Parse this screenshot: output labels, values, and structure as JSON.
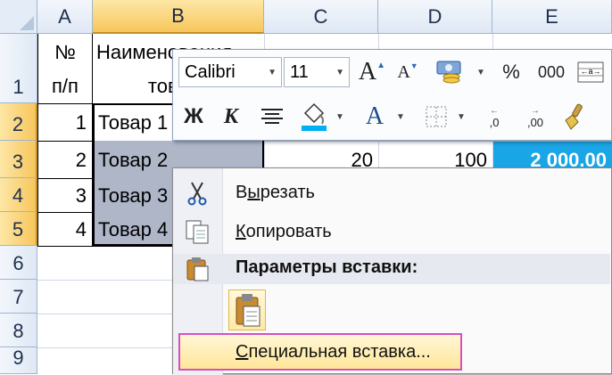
{
  "sheet": {
    "columns": [
      "A",
      "B",
      "C",
      "D",
      "E"
    ],
    "rows": [
      "1",
      "2",
      "3",
      "4",
      "5",
      "6",
      "7",
      "8",
      "9"
    ],
    "header_row": {
      "a_top": "№",
      "a_bottom": "п/п",
      "b_top": "Наименования",
      "b_bottom": "товара"
    },
    "data_rows": [
      {
        "num": "1",
        "name": "Товар 1"
      },
      {
        "num": "2",
        "name": "Товар 2",
        "c": "20",
        "d": "100",
        "e": "2 000.00"
      },
      {
        "num": "3",
        "name": "Товар 3"
      },
      {
        "num": "4",
        "name": "Товар 4"
      }
    ],
    "colors": {
      "header_select": "#f7c65c",
      "selected_cells": "#aeb6c8",
      "total_cell": "#1aa5e6"
    }
  },
  "mini_toolbar": {
    "font_name": "Calibri",
    "font_size": "11",
    "bold": "Ж",
    "italic": "К",
    "percent": "%",
    "thousands": "000",
    "grow_font": "A",
    "shrink_font": "A",
    "font_color": "A",
    "increase_decimal": ",0",
    "decrease_decimal": ",00",
    "fill_color": "#00b0f0",
    "font_color_bar": "#e0e0e0"
  },
  "context_menu": {
    "cut": {
      "u": "ы",
      "pre": "В",
      "post": "резать"
    },
    "copy": {
      "u": "К",
      "pre": "",
      "post": "опировать"
    },
    "paste_params": "Параметры вставки:",
    "paste_special": {
      "u": "С",
      "pre": "",
      "post": "пециальная вставка..."
    }
  }
}
